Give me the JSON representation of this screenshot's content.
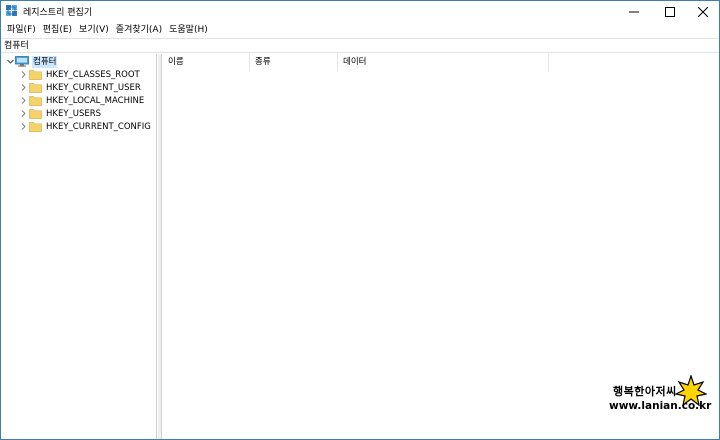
{
  "window": {
    "title": "레지스트리 편집기",
    "controls": {
      "minimize": "minimize-icon",
      "maximize": "maximize-icon",
      "close": "close-icon"
    }
  },
  "menu": [
    {
      "label": "파일(F)"
    },
    {
      "label": "편집(E)"
    },
    {
      "label": "보기(V)"
    },
    {
      "label": "즐겨찾기(A)"
    },
    {
      "label": "도움말(H)"
    }
  ],
  "address": {
    "value": "컴퓨터"
  },
  "tree": {
    "root": {
      "label": "컴퓨터",
      "icon": "computer-icon",
      "expanded": true,
      "selected": true
    },
    "children": [
      {
        "label": "HKEY_CLASSES_ROOT",
        "icon": "folder-icon"
      },
      {
        "label": "HKEY_CURRENT_USER",
        "icon": "folder-icon"
      },
      {
        "label": "HKEY_LOCAL_MACHINE",
        "icon": "folder-icon"
      },
      {
        "label": "HKEY_USERS",
        "icon": "folder-icon"
      },
      {
        "label": "HKEY_CURRENT_CONFIG",
        "icon": "folder-icon"
      }
    ]
  },
  "list": {
    "columns": [
      {
        "label": "이름"
      },
      {
        "label": "종류"
      },
      {
        "label": "데이터"
      }
    ],
    "rows": []
  },
  "watermark": {
    "text": "행복한아저씨",
    "url": "www.lanian.co.kr"
  },
  "colors": {
    "selection": "#cce8ff",
    "border": "#3c7fb1",
    "folder": "#f5d26b",
    "computer": "#4aa3df"
  }
}
